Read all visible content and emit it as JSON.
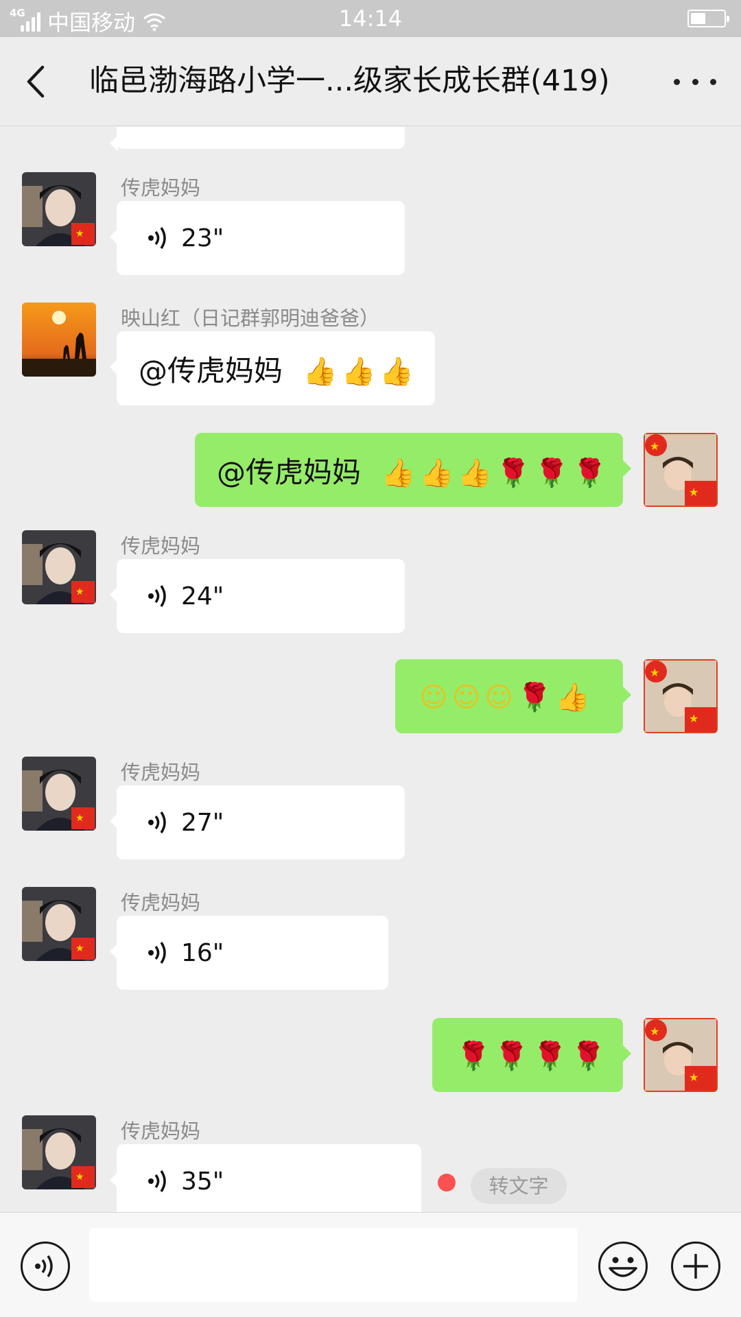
{
  "status_bar": {
    "network": "4G",
    "carrier": "中国移动",
    "time": "14:14",
    "battery_level": 0.45,
    "icons": [
      "signal-icon",
      "wifi-icon",
      "battery-icon"
    ]
  },
  "header": {
    "title": "临邑渤海路小学一...级家长成长群(419)",
    "back_icon": "chevron-left-icon",
    "more_icon": "more-icon"
  },
  "messages": [
    {
      "sender": "传虎妈妈",
      "type": "voice",
      "duration": "23\""
    },
    {
      "sender": "映山红（日记群郭明迪爸爸）",
      "type": "text",
      "text": "@传虎妈妈"
    },
    {
      "sender": "",
      "type": "text",
      "text": "@传虎妈妈",
      "outgoing": true
    },
    {
      "sender": "传虎妈妈",
      "type": "voice",
      "duration": "24\""
    },
    {
      "sender": "",
      "type": "emoji",
      "outgoing": true
    },
    {
      "sender": "传虎妈妈",
      "type": "voice",
      "duration": "27\""
    },
    {
      "sender": "传虎妈妈",
      "type": "voice",
      "duration": "16\""
    },
    {
      "sender": "",
      "type": "emoji",
      "outgoing": true
    },
    {
      "sender": "传虎妈妈",
      "type": "voice",
      "duration": "35\""
    }
  ],
  "voice_to_text_label": "转文字",
  "input_bar": {
    "placeholder": "",
    "icons": [
      "voice-input-icon",
      "emoji-icon",
      "plus-icon"
    ]
  },
  "colors": {
    "outgoing_bubble": "#95ec69",
    "incoming_bubble": "#ffffff",
    "background": "#ededed",
    "unread_dot": "#fa5151"
  }
}
